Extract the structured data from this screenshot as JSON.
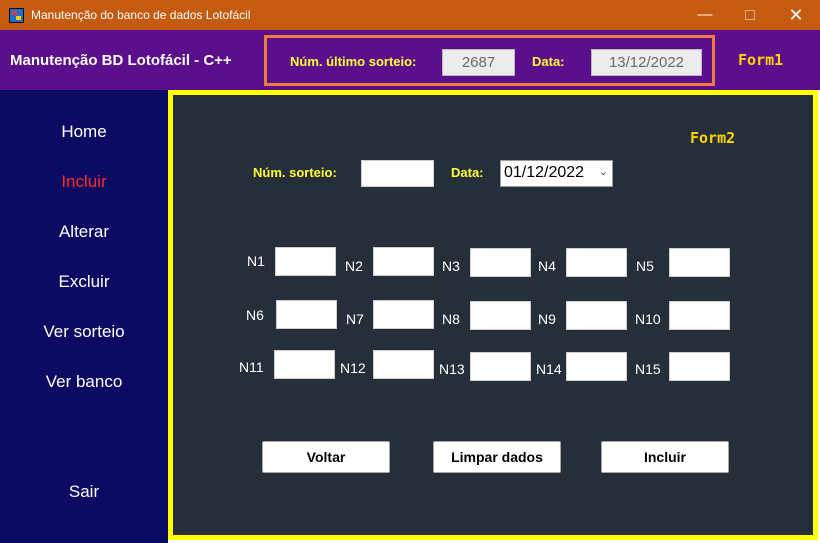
{
  "window": {
    "title": "Manutenção do banco de dados Lotofácil",
    "icon": "app-grid-icon",
    "controls": {
      "minimize": "—",
      "maximize": "",
      "close": "✕"
    }
  },
  "header": {
    "title": "Manutenção BD Lotofácil - C++",
    "last_draw_label": "Núm. último sorteio:",
    "last_draw_value": "2687",
    "date_label": "Data:",
    "date_value": "13/12/2022",
    "form_tag": "Form1"
  },
  "sidebar": {
    "items": [
      {
        "label": "Home"
      },
      {
        "label": "Incluir"
      },
      {
        "label": "Alterar"
      },
      {
        "label": "Excluir"
      },
      {
        "label": "Ver sorteio"
      },
      {
        "label": "Ver banco"
      },
      {
        "label": "Sair"
      }
    ],
    "active_index": 1
  },
  "form": {
    "tag": "Form2",
    "draw_label": "Núm. sorteio:",
    "draw_value": "",
    "date_label": "Data:",
    "date_value": "01/12/2022",
    "numbers": [
      {
        "label": "N1",
        "value": ""
      },
      {
        "label": "N2",
        "value": ""
      },
      {
        "label": "N3",
        "value": ""
      },
      {
        "label": "N4",
        "value": ""
      },
      {
        "label": "N5",
        "value": ""
      },
      {
        "label": "N6",
        "value": ""
      },
      {
        "label": "N7",
        "value": ""
      },
      {
        "label": "N8",
        "value": ""
      },
      {
        "label": "N9",
        "value": ""
      },
      {
        "label": "N10",
        "value": ""
      },
      {
        "label": "N11",
        "value": ""
      },
      {
        "label": "N12",
        "value": ""
      },
      {
        "label": "N13",
        "value": ""
      },
      {
        "label": "N14",
        "value": ""
      },
      {
        "label": "N15",
        "value": ""
      }
    ],
    "buttons": {
      "back": "Voltar",
      "clear": "Limpar dados",
      "submit": "Incluir"
    }
  },
  "colors": {
    "titlebar": "#c55a11",
    "header": "#5b0f8c",
    "sidebar": "#0b0b63",
    "panel": "#262e3a",
    "panel_border": "#ffff00",
    "label_yellow": "#ffff33",
    "active_item": "#ff2a2a",
    "group_frame": "#f07c3c"
  }
}
